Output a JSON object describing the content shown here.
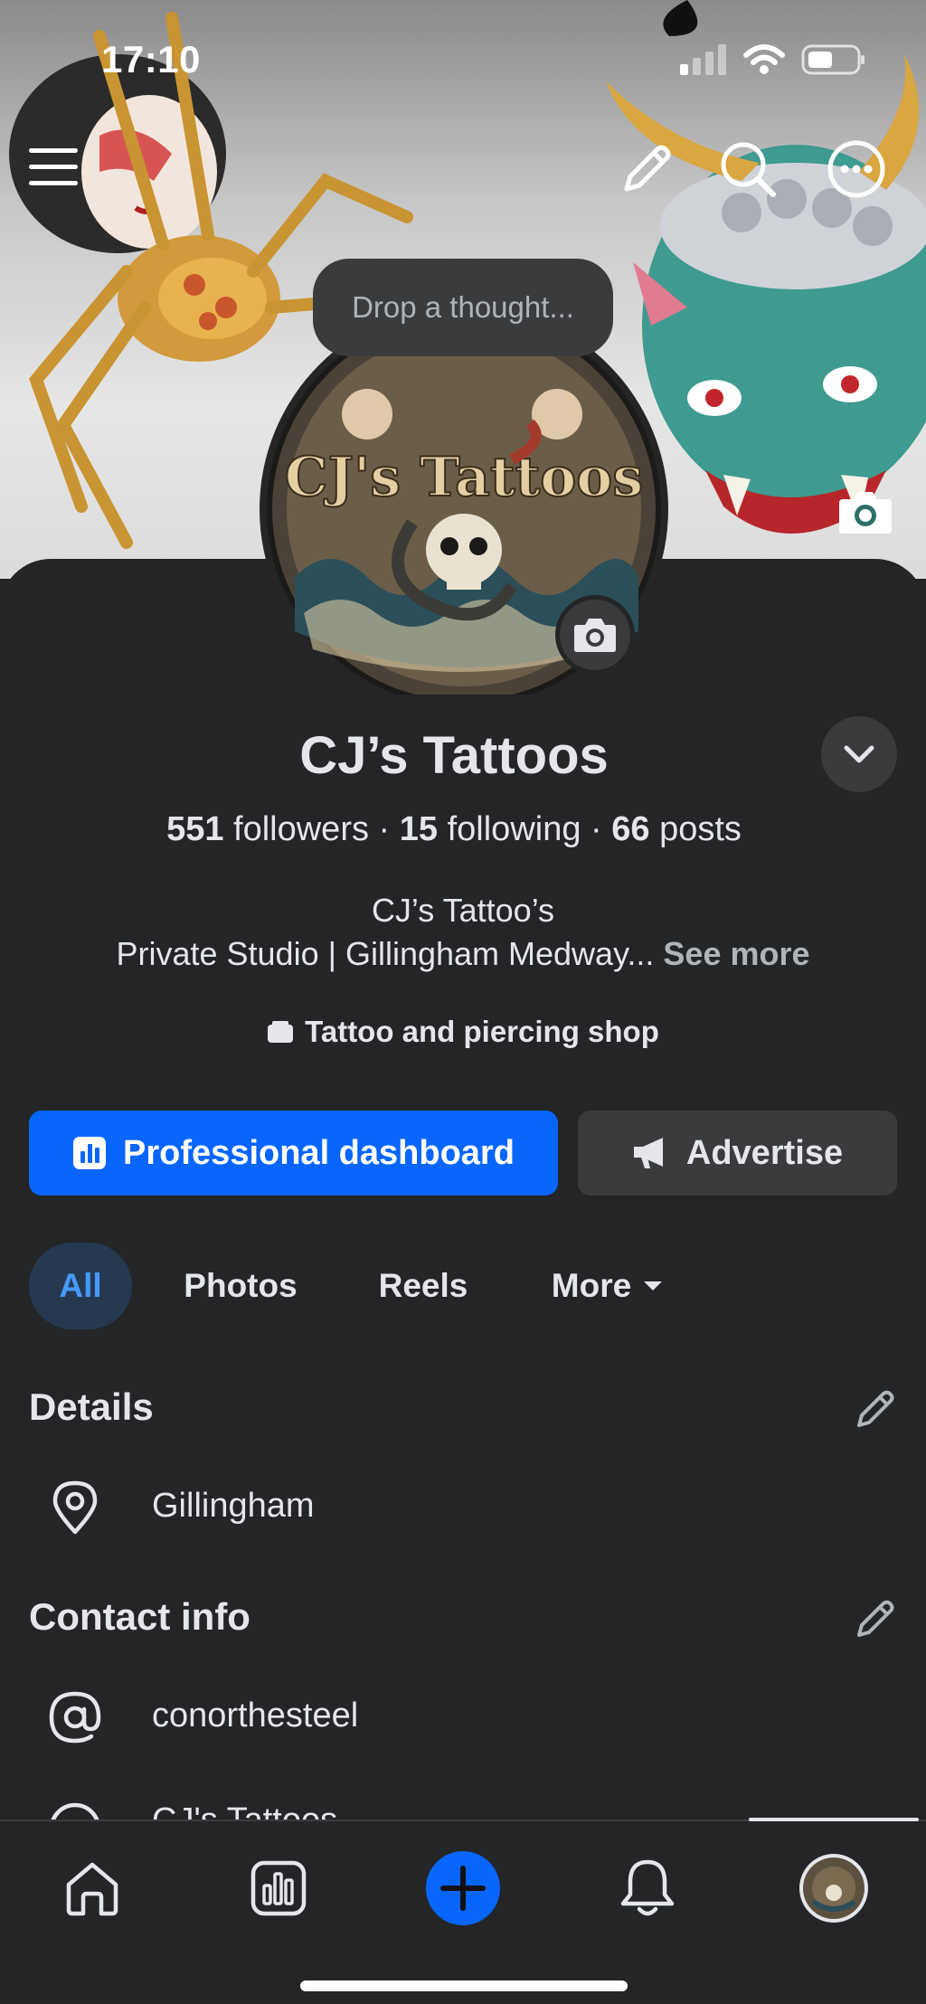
{
  "status_bar": {
    "time": "17:10"
  },
  "cover": {
    "composer_placeholder": "Drop a thought...",
    "avatar_logo_text": "CJ's Tattoos"
  },
  "icons": {
    "menu": "menu-icon",
    "edit": "pencil-icon",
    "search": "search-icon",
    "more": "more-icon",
    "camera": "camera-icon",
    "chevron": "chevron-down-icon",
    "location": "location-pin-icon",
    "at": "at-sign-icon"
  },
  "profile": {
    "name": "CJ’s Tattoos",
    "stats": {
      "followers_count": "551",
      "followers_label": "followers",
      "following_count": "15",
      "following_label": "following",
      "posts_count": "66",
      "posts_label": "posts",
      "separator": "·"
    },
    "bio_line1": "CJ’s Tattoo’s",
    "bio_line2": "Private Studio | Gillingham Medway...",
    "see_more": "See more",
    "category": "Tattoo and piercing shop"
  },
  "actions": {
    "primary": "Professional dashboard",
    "secondary": "Advertise"
  },
  "tabs": [
    {
      "label": "All"
    },
    {
      "label": "Photos"
    },
    {
      "label": "Reels"
    },
    {
      "label": "More"
    }
  ],
  "details": {
    "title": "Details",
    "location": "Gillingham"
  },
  "contact": {
    "title": "Contact info",
    "username": "conorthesteel",
    "partial_row": "CJ's Tattoos"
  },
  "colors": {
    "accent": "#0866ff",
    "background": "#242526",
    "surface": "#3a3b3c",
    "active_tab_bg": "#263951",
    "active_tab_text": "#4599ff"
  }
}
